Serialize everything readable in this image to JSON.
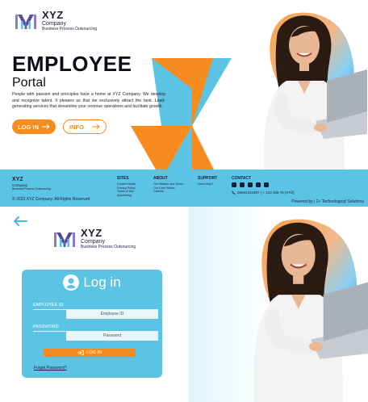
{
  "landing": {
    "brand": "XYZ",
    "company": "Company",
    "tagline": "Business Process Outsourcing",
    "hero_title": "EMPLOYEE",
    "hero_subtitle": "Portal",
    "hero_description": "People with passion and principles have a home at XYZ Company. We develop and recognize talent. It pleases us that we exclusively attract the best. Lead-generating services that streamline your revenue operations and facilitate growth.",
    "login_button": "LOG IN",
    "info_button": "INFO"
  },
  "footer": {
    "brand": "XYZ",
    "company": "Company",
    "tagline": "Business Process Outsourcing",
    "copyright": "© 2023 XYZ Company. All Rights Reserved",
    "powered_by": "Powered by | 2+ Technological Solutions",
    "sites": {
      "heading": "SITES",
      "links": [
        "Content Guide",
        "Privacy Policy",
        "Terms of Use",
        "Advertising"
      ]
    },
    "about": {
      "heading": "ABOUT",
      "links": [
        "Our Mission and Vision",
        "Our Core Values",
        "Careers"
      ]
    },
    "support": {
      "heading": "SUPPORT",
      "links": [
        "Need Help?"
      ]
    },
    "contact": {
      "heading": "CONTACT",
      "phone": "09564321897 | + 123 456 78 (XYZ)"
    }
  },
  "login": {
    "brand": "XYZ",
    "company": "Company",
    "tagline": "Business Process Outsourcing",
    "title": "Log in",
    "employee_id_label": "EMPLOYEE ID",
    "employee_id_placeholder": "Employee ID",
    "password_label": "PASSWORD",
    "password_placeholder": "Password",
    "submit_label": "LOG IN",
    "forgot_label": "Forget Password?"
  },
  "colors": {
    "accent_orange": "#f68b1f",
    "accent_blue": "#5bc4e4",
    "dark": "#1c1c3a"
  }
}
